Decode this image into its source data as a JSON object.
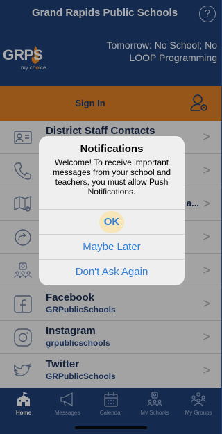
{
  "header": {
    "title": "Grand Rapids Public Schools",
    "help_icon": "?"
  },
  "banner": {
    "logo_text": "GRPS",
    "logo_tag_prefix": "my ch",
    "logo_tag_accent": "o",
    "logo_tag_suffix": "ice",
    "notice": "Tomorrow: No School; No LOOP Programming"
  },
  "signin": {
    "label": "Sign In"
  },
  "list": {
    "rows": [
      {
        "title": "District Staff Contacts",
        "subtitle": "",
        "trail": "",
        "icon": "contact-card-icon"
      },
      {
        "title": "",
        "subtitle": "",
        "trail": "",
        "icon": "phone-icon"
      },
      {
        "title": "",
        "subtitle": "",
        "trail": "a...",
        "icon": "map-icon"
      },
      {
        "title": "",
        "subtitle": "",
        "trail": "",
        "icon": "share-arrow-icon"
      },
      {
        "title": "",
        "subtitle": "",
        "trail": "",
        "icon": "groups-icon"
      },
      {
        "title": "Facebook",
        "subtitle": "GRPublicSchools",
        "trail": "",
        "icon": "facebook-icon"
      },
      {
        "title": "Instagram",
        "subtitle": "grpublicschools",
        "trail": "",
        "icon": "instagram-icon"
      },
      {
        "title": "Twitter",
        "subtitle": "GRPublicSchools",
        "trail": "",
        "icon": "twitter-icon"
      }
    ],
    "chevron": ">"
  },
  "dialog": {
    "title": "Notifications",
    "message": "Welcome! To receive important messages from your school and teachers, you must allow Push Notifications.",
    "ok_label": "OK",
    "later_label": "Maybe Later",
    "never_label": "Don't Ask Again"
  },
  "tabs": [
    {
      "label": "Home",
      "icon": "school-house-icon",
      "active": true
    },
    {
      "label": "Messages",
      "icon": "megaphone-icon",
      "active": false
    },
    {
      "label": "Calendar",
      "icon": "calendar-icon",
      "active": false
    },
    {
      "label": "My Schools",
      "icon": "my-schools-icon",
      "active": false
    },
    {
      "label": "My Groups",
      "icon": "my-groups-icon",
      "active": false
    }
  ],
  "colors": {
    "navy": "#1f4177",
    "orange": "#e07f26",
    "ios_blue": "#2f7fd6"
  }
}
